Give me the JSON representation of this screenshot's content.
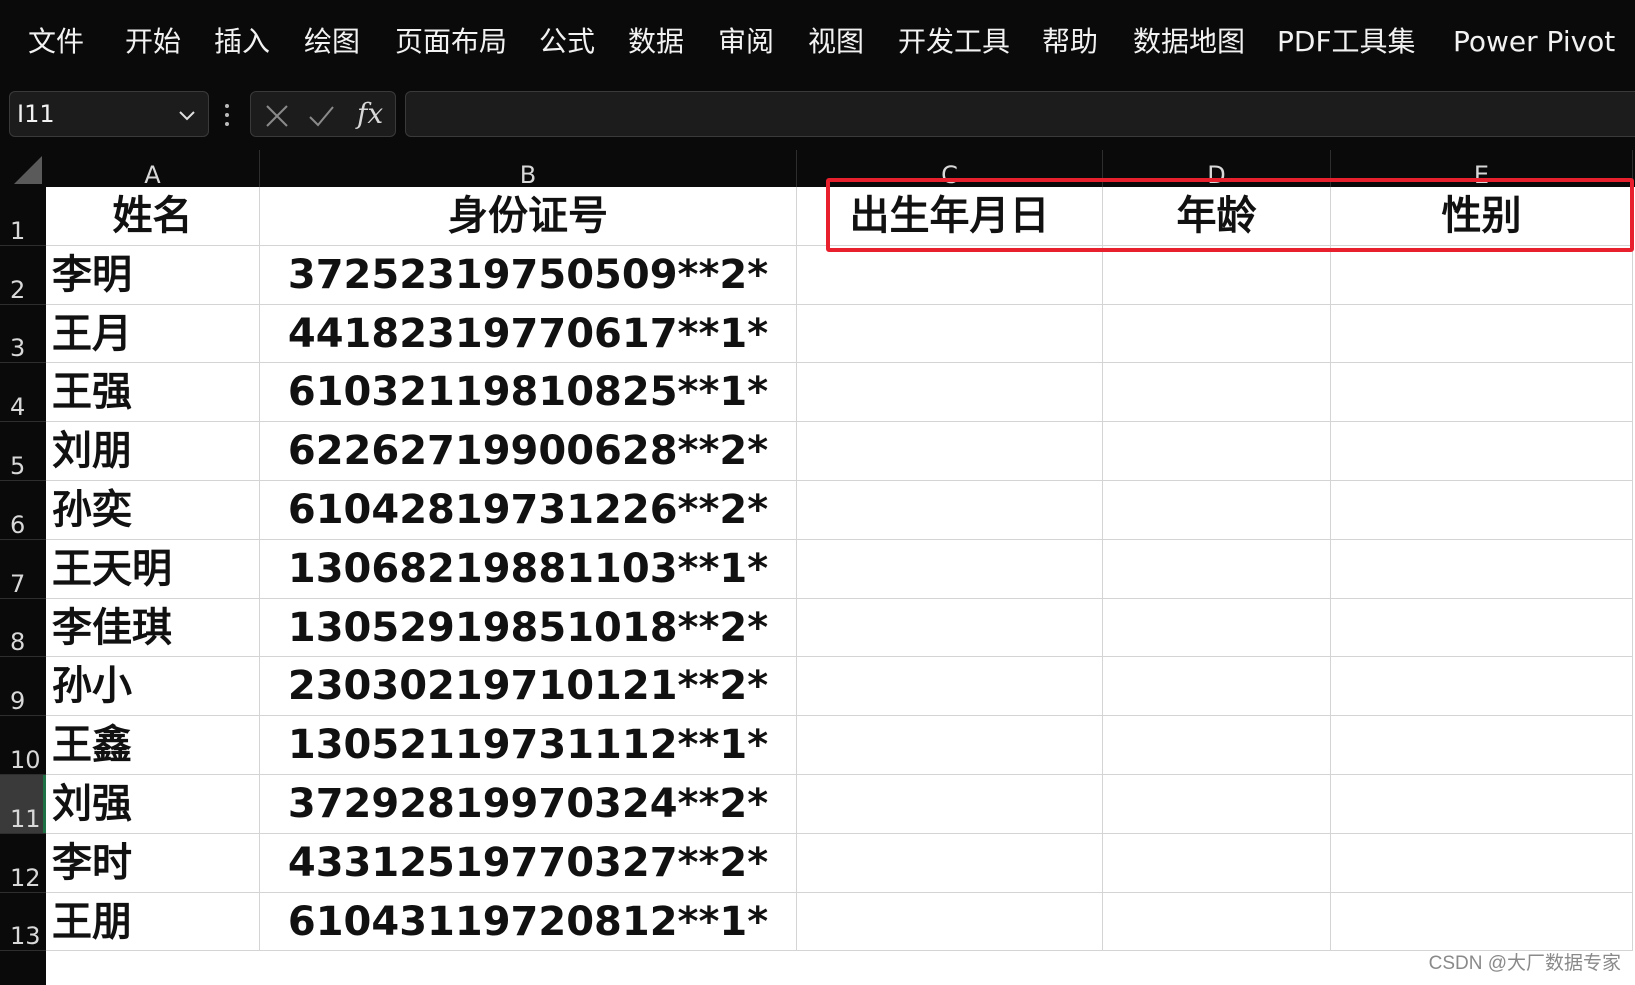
{
  "menu": {
    "items": [
      "文件",
      "开始",
      "插入",
      "绘图",
      "页面布局",
      "公式",
      "数据",
      "审阅",
      "视图",
      "开发工具",
      "帮助",
      "数据地图",
      "PDF工具集",
      "Power Pivot"
    ]
  },
  "formula_bar": {
    "name_box": "I11",
    "fx_label": "fx",
    "formula": ""
  },
  "sheet": {
    "columns": [
      "A",
      "B",
      "C",
      "D",
      "E"
    ],
    "rows": [
      "1",
      "2",
      "3",
      "4",
      "5",
      "6",
      "7",
      "8",
      "9",
      "10",
      "11",
      "12",
      "13"
    ],
    "active_row": "11",
    "headers": [
      "姓名",
      "身份证号",
      "出生年月日",
      "年龄",
      "性别"
    ],
    "records": [
      {
        "name": "李明",
        "id": "37252319750509**2*"
      },
      {
        "name": "王月",
        "id": "44182319770617**1*"
      },
      {
        "name": "王强",
        "id": "61032119810825**1*"
      },
      {
        "name": "刘朋",
        "id": "62262719900628**2*"
      },
      {
        "name": "孙奕",
        "id": "61042819731226**2*"
      },
      {
        "name": "王天明",
        "id": "13068219881103**1*"
      },
      {
        "name": "李佳琪",
        "id": "13052919851018**2*"
      },
      {
        "name": "孙小",
        "id": "23030219710121**2*"
      },
      {
        "name": "王鑫",
        "id": "13052119731112**1*"
      },
      {
        "name": "刘强",
        "id": "37292819970324**2*"
      },
      {
        "name": "李时",
        "id": "43312519770327**2*"
      },
      {
        "name": "王朋",
        "id": "61043119720812**1*"
      }
    ]
  },
  "highlight_color": "#e8202e",
  "watermark": "CSDN @大厂数据专家"
}
